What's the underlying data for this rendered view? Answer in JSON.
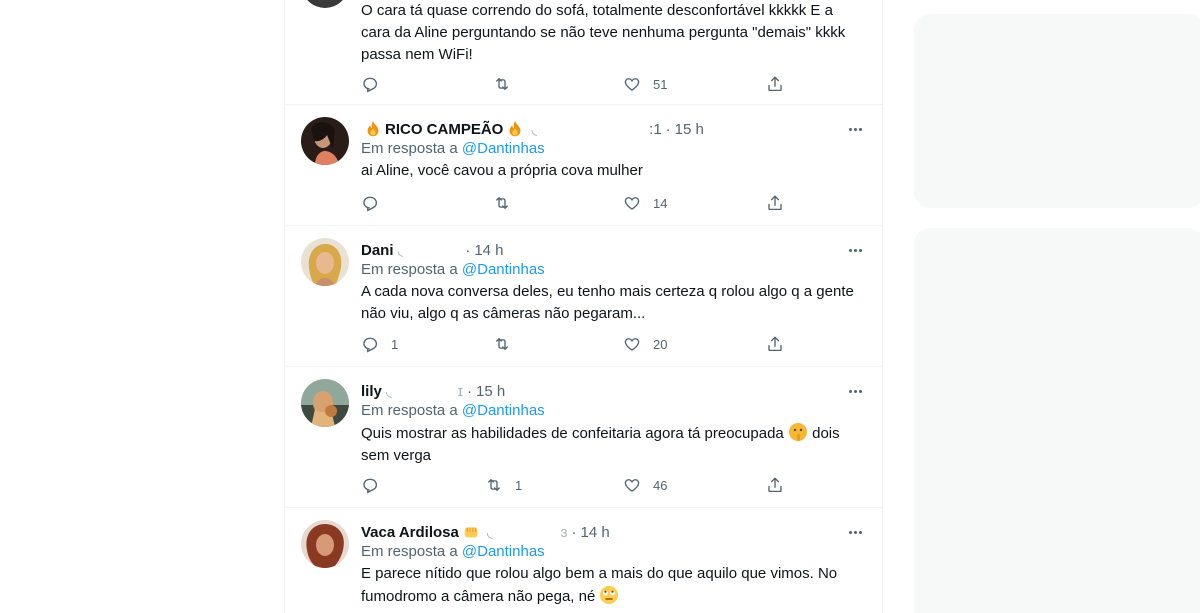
{
  "tweets": [
    {
      "name": "",
      "handle": "",
      "time": "",
      "reply_label": "",
      "reply_mention": "",
      "text": "O cara tá quase correndo do sofá,  totalmente desconfortável kkkkk E a cara da Aline perguntando se não teve nenhuma pergunta \"demais\" kkkk passa nem WiFi!",
      "replies": "",
      "retweets": "",
      "likes": "51"
    },
    {
      "name": "RICO CAMPEÃO",
      "handle_end": ":1",
      "dot": "·",
      "time": "15 h",
      "reply_label": "Em resposta a",
      "reply_mention": "@Dantinhas",
      "text": "ai Aline, você cavou a própria cova mulher",
      "replies": "",
      "retweets": "",
      "likes": "14"
    },
    {
      "name": "Dani",
      "dot": "·",
      "time": "14 h",
      "reply_label": "Em resposta a",
      "reply_mention": "@Dantinhas",
      "text": "A cada nova conversa deles, eu tenho mais certeza q rolou algo q a gente não viu, algo q as câmeras não pegaram...",
      "replies": "1",
      "retweets": "",
      "likes": "20"
    },
    {
      "name": "lily",
      "dot": "·",
      "time": "15 h",
      "reply_label": "Em resposta a",
      "reply_mention": "@Dantinhas",
      "text": "Quis mostrar as habilidades de confeitaria agora tá preocupada",
      "text_after": " dois sem verga",
      "replies": "",
      "retweets": "1",
      "likes": "46"
    },
    {
      "name": "Vaca Ardilosa",
      "dot": "·",
      "time": "14 h",
      "reply_label": "Em resposta a",
      "reply_mention": "@Dantinhas",
      "text": "E parece nítido que rolou algo bem a mais do que aquilo que vimos. No fumodromo a câmera não pega, né",
      "replies": "",
      "retweets": "",
      "likes": ""
    }
  ],
  "icons": {
    "reply": "reply-icon",
    "retweet": "retweet-icon",
    "like": "heart-icon",
    "share": "share-icon",
    "more": "more-options-icon",
    "fire": "fire-emoji",
    "fist": "fist-emoji",
    "shush": "shushing-face-emoji",
    "eyeroll": "eye-roll-emoji"
  },
  "colors": {
    "accent": "#1d9bf0",
    "secondary_text": "#536471",
    "border": "#eff3f4"
  }
}
